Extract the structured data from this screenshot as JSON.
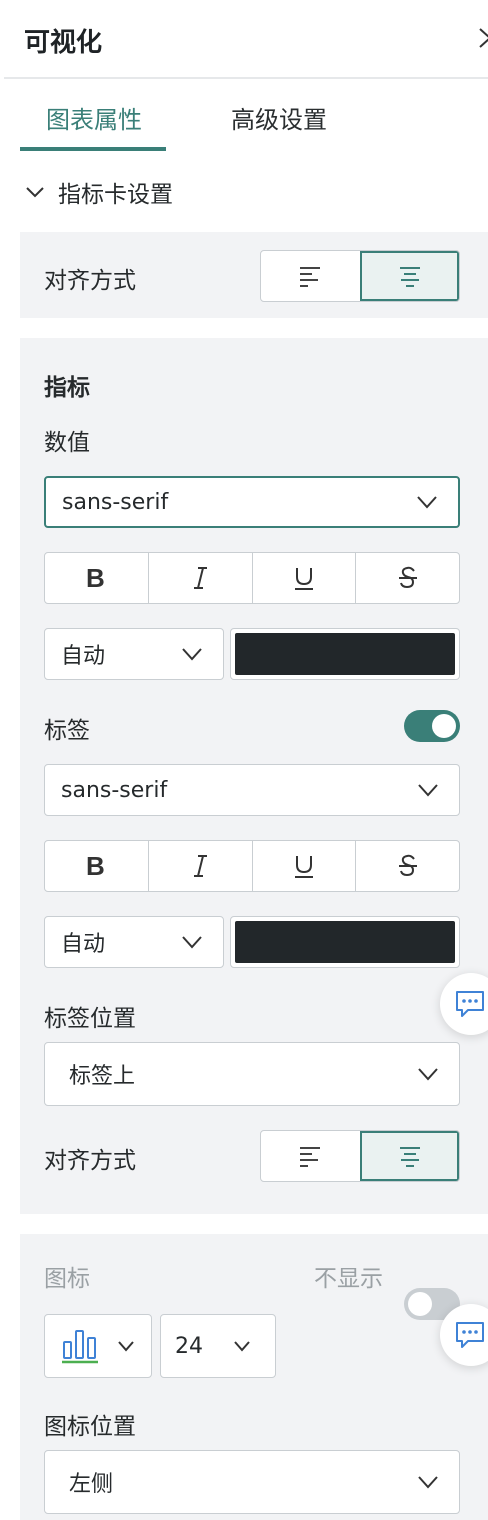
{
  "panel": {
    "title": "可视化"
  },
  "tabs": [
    {
      "label": "图表属性",
      "active": true
    },
    {
      "label": "高级设置",
      "active": false
    }
  ],
  "section": {
    "title": "指标卡设置",
    "expanded": true
  },
  "card_alignment": {
    "label": "对齐方式",
    "selected": "center"
  },
  "indicator": {
    "title": "指标",
    "value": {
      "label": "数值",
      "font": "sans-serif",
      "size": "自动",
      "color": "#22272a",
      "styles": [
        "bold",
        "italic",
        "underline",
        "strikethrough"
      ]
    },
    "tag": {
      "label": "标签",
      "enabled": true,
      "font": "sans-serif",
      "size": "自动",
      "color": "#22272a",
      "styles": [
        "bold",
        "italic",
        "underline",
        "strikethrough"
      ]
    },
    "tag_position": {
      "label": "标签位置",
      "value": "标签上"
    },
    "alignment": {
      "label": "对齐方式",
      "selected": "center"
    }
  },
  "icon_section": {
    "title": "图标",
    "toggle_label": "不显示",
    "enabled": false,
    "icon": "bar-chart-icon",
    "size": "24",
    "position": {
      "label": "图标位置",
      "value": "左侧"
    }
  },
  "colors": {
    "accent": "#3a7f78",
    "card_bg": "#f2f3f5",
    "border": "#c9ced2",
    "icon_blue": "#3f82d6",
    "icon_green": "#4caf50"
  }
}
